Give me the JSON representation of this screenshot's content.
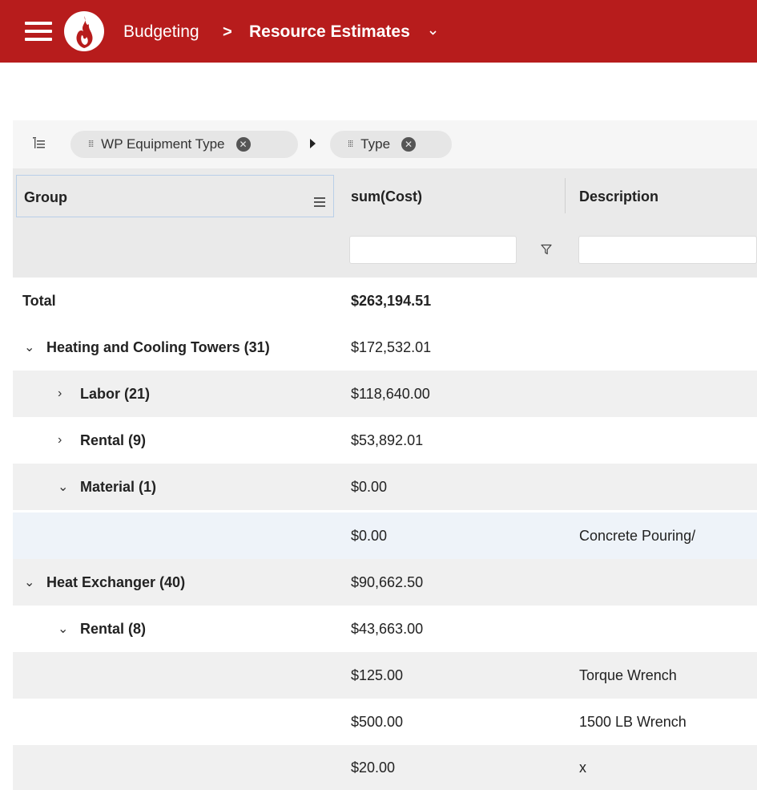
{
  "header": {
    "breadcrumb_parent": "Budgeting",
    "breadcrumb_separator": ">",
    "breadcrumb_current": "Resource Estimates",
    "bar_color": "#b71c1c",
    "icons": [
      "menu-icon",
      "flame-logo",
      "chevron-down-icon"
    ]
  },
  "group_panel": {
    "chips": [
      {
        "label": "WP Equipment Type"
      },
      {
        "label": "Type"
      }
    ]
  },
  "grid": {
    "columns": {
      "group": "Group",
      "cost": "sum(Cost)",
      "description": "Description"
    },
    "filters": {
      "cost_value": "",
      "description_value": ""
    },
    "rows": [
      {
        "group": "Total",
        "cost": "$263,194.51",
        "description": ""
      },
      {
        "group": "Heating and Cooling Towers (31)",
        "cost": "$172,532.01",
        "description": ""
      },
      {
        "group": "Labor (21)",
        "cost": "$118,640.00",
        "description": ""
      },
      {
        "group": "Rental (9)",
        "cost": "$53,892.01",
        "description": ""
      },
      {
        "group": "Material (1)",
        "cost": "$0.00",
        "description": ""
      },
      {
        "group": "",
        "cost": "$0.00",
        "description": "Concrete Pouring/"
      },
      {
        "group": "Heat Exchanger (40)",
        "cost": "$90,662.50",
        "description": ""
      },
      {
        "group": "Rental (8)",
        "cost": "$43,663.00",
        "description": ""
      },
      {
        "group": "",
        "cost": "$125.00",
        "description": "Torque Wrench"
      },
      {
        "group": "",
        "cost": "$500.00",
        "description": "1500 LB Wrench"
      },
      {
        "group": "",
        "cost": "$20.00",
        "description": "x"
      }
    ]
  }
}
